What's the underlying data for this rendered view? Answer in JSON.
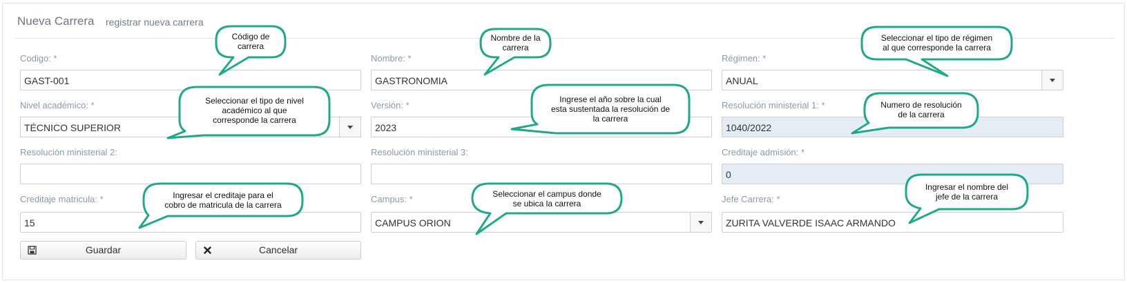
{
  "header": {
    "title": "Nueva Carrera",
    "subtitle": "registrar nueva carrera"
  },
  "form": {
    "codigo": {
      "label": "Codigo: *",
      "value": "GAST-001"
    },
    "nombre": {
      "label": "Nombre: *",
      "value": "GASTRONOMIA"
    },
    "regimen": {
      "label": "Régimen: *",
      "value": "ANUAL"
    },
    "nivel": {
      "label": "Nivel académico: *",
      "value": "TÉCNICO SUPERIOR"
    },
    "version": {
      "label": "Versión: *",
      "value": "2023"
    },
    "res1": {
      "label": "Resolución ministerial 1: *",
      "value": "1040/2022"
    },
    "res2": {
      "label": "Resolución ministerial 2:",
      "value": ""
    },
    "res3": {
      "label": "Resolución ministerial 3:",
      "value": ""
    },
    "cred_admision": {
      "label": "Creditaje admisión: *",
      "value": "0"
    },
    "cred_matricula": {
      "label": "Creditaje matricula: *",
      "value": "15"
    },
    "campus": {
      "label": "Campus: *",
      "value": "CAMPUS ORION"
    },
    "jefe": {
      "label": "Jefe Carrera: *",
      "value": "ZURITA  VALVERDE ISAAC ARMANDO"
    }
  },
  "buttons": {
    "save": {
      "label": "Guardar",
      "icon": "floppy-disk-icon"
    },
    "cancel": {
      "label": "Cancelar",
      "icon": "close-x-icon"
    }
  },
  "callouts": {
    "codigo": [
      "Código de",
      "carrera"
    ],
    "nombre": [
      "Nombre de la",
      "carrera"
    ],
    "regimen": [
      "Seleccionar el tipo de régimen",
      "al que  corresponde la carrera"
    ],
    "nivel": [
      "Seleccionar el tipo de nivel",
      "académico al que",
      "corresponde la carrera"
    ],
    "version": [
      "Ingrese el año  sobre la cual",
      "esta sustentada la resolución de",
      "la carrera"
    ],
    "resolucion": [
      "Numero de resolución",
      "de la carrera"
    ],
    "creditaje": [
      "Ingresar el creditaje para el",
      "cobro de matricula  de la carrera"
    ],
    "campus": [
      "Seleccionar el campus donde",
      "se ubica la carrera"
    ],
    "jefe": [
      "Ingresar el nombre del",
      "jefe de la carrera"
    ]
  },
  "colors": {
    "callout_border": "#1fa88a",
    "readonly_bg": "#e6ecf6",
    "label": "#8a9aab"
  }
}
